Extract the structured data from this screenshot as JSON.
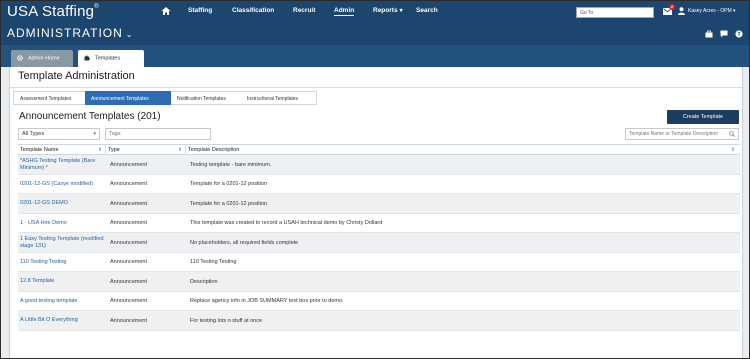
{
  "app": {
    "logo": "USA Staffing",
    "logo_mark": "®"
  },
  "topnav": {
    "items": [
      {
        "label": "Staffing"
      },
      {
        "label": "Classification"
      },
      {
        "label": "Recruit"
      },
      {
        "label": "Admin"
      },
      {
        "label": "Reports"
      },
      {
        "label": "Search"
      }
    ],
    "goto_placeholder": "Go To",
    "mail_count": "2",
    "user_name": "Kasey Acres - OPM"
  },
  "admin_bar": {
    "title": "ADMINISTRATION"
  },
  "tabs": [
    {
      "label": "Admin Home"
    },
    {
      "label": "Templates"
    }
  ],
  "page": {
    "title": "Template Administration",
    "breadcrumbs": [
      {
        "label": "Assessment Templates"
      },
      {
        "label": "Announcement Templates"
      },
      {
        "label": "Notification Templates"
      },
      {
        "label": "Instructional Templates"
      }
    ],
    "section_title": "Announcement Templates (201)",
    "create_button": "Create Template",
    "filter_type": "All Types",
    "tags_placeholder": "Tags",
    "search_placeholder": "Template Name or Template Description"
  },
  "table": {
    "columns": [
      "Template Name",
      "Type",
      "Template Description"
    ],
    "rows": [
      {
        "name": "*ASHG Testing Template (Bare Minimum) *",
        "type": "Announcement",
        "desc": "Testing template - bare minimum."
      },
      {
        "name": "0201-12-GS (Casye modified)",
        "type": "Announcement",
        "desc": "Template for a 0201-12 position"
      },
      {
        "name": "0201-12-GS DEMO",
        "type": "Announcement",
        "desc": "Template for a 0201-12 position"
      },
      {
        "name": "1 - USA Hire Demo",
        "type": "Announcement",
        "desc": "This template was created to record a USAH technical demo by Christy Dollard"
      },
      {
        "name": "1 Easy Testing Template (modified stage 131)",
        "type": "Announcement",
        "desc": "No placeholders, all required fields complete"
      },
      {
        "name": "110 Testing Testing",
        "type": "Announcement",
        "desc": "110 Testing Testing"
      },
      {
        "name": "12.8 Template",
        "type": "Announcement",
        "desc": "Description"
      },
      {
        "name": "A good testing template",
        "type": "Announcement",
        "desc": "Replace agency info in JOB SUMMARY text box prior to demo."
      },
      {
        "name": "A Little Bit O Everything",
        "type": "Announcement",
        "desc": "For testing lots o stuff at once"
      }
    ]
  },
  "colors": {
    "nav_bg": "#1c4570",
    "accent": "#2d6db5",
    "link": "#2a63a5",
    "badge": "#d9232e"
  }
}
